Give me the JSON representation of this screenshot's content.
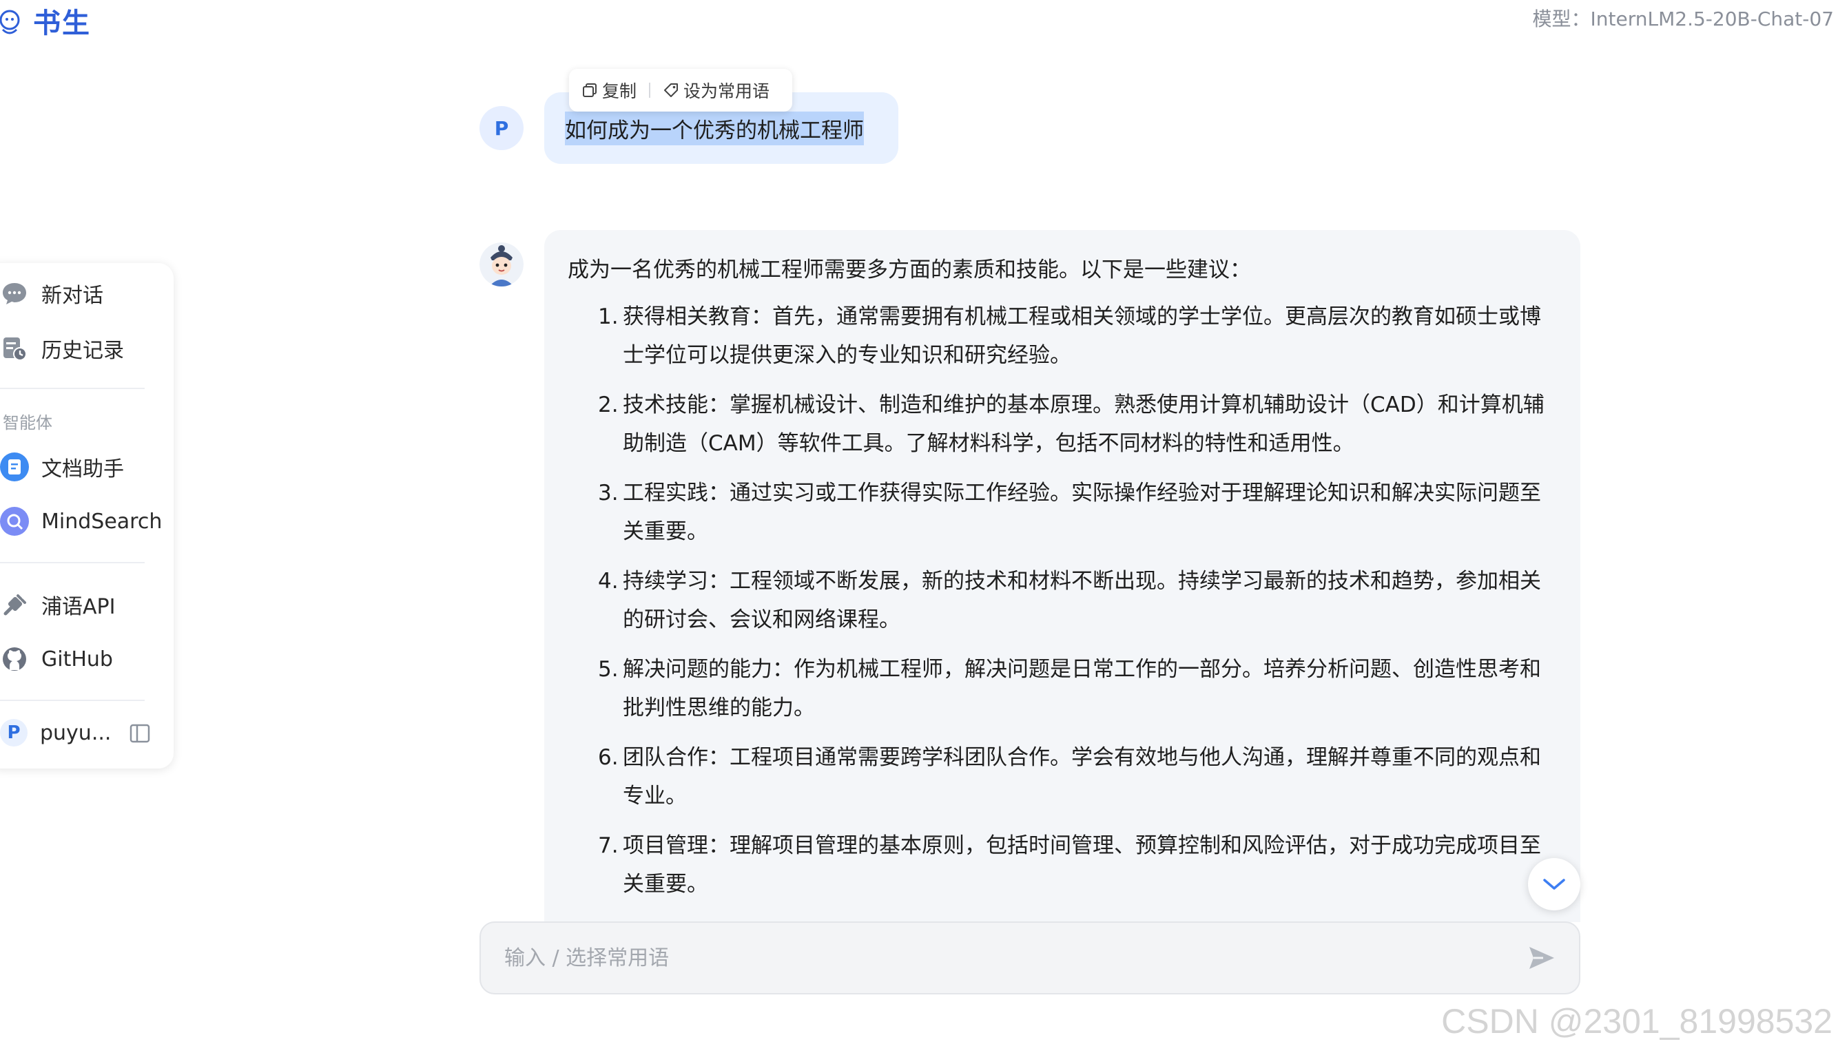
{
  "brand": {
    "name": "书生"
  },
  "header": {
    "model_label": "模型：InternLM2.5-20B-Chat-07"
  },
  "sidebar": {
    "items": [
      {
        "label": "新对话",
        "icon": "chat-bubble-icon"
      },
      {
        "label": "历史记录",
        "icon": "history-icon"
      }
    ],
    "agents_section_title": "智能体",
    "agents": [
      {
        "label": "文档助手",
        "icon": "document-assistant-icon"
      },
      {
        "label": "MindSearch",
        "icon": "mindsearch-icon"
      }
    ],
    "links": [
      {
        "label": "浦语API",
        "icon": "plug-icon"
      },
      {
        "label": "GitHub",
        "icon": "github-icon"
      }
    ],
    "user": {
      "avatar_letter": "P",
      "name": "puyu..."
    }
  },
  "chat": {
    "user_avatar_letter": "P",
    "toolbar": {
      "copy_label": "复制",
      "save_phrase_label": "设为常用语"
    },
    "user_message": "如何成为一个优秀的机械工程师",
    "bot_intro": "成为一名优秀的机械工程师需要多方面的素质和技能。以下是一些建议：",
    "bot_points": [
      {
        "num": "1.",
        "text": "获得相关教育：首先，通常需要拥有机械工程或相关领域的学士学位。更高层次的教育如硕士或博士学位可以提供更深入的专业知识和研究经验。"
      },
      {
        "num": "2.",
        "text": "技术技能：掌握机械设计、制造和维护的基本原理。熟悉使用计算机辅助设计（CAD）和计算机辅助制造（CAM）等软件工具。了解材料科学，包括不同材料的特性和适用性。"
      },
      {
        "num": "3.",
        "text": "工程实践：通过实习或工作获得实际工作经验。实际操作经验对于理解理论知识和解决实际问题至关重要。"
      },
      {
        "num": "4.",
        "text": "持续学习：工程领域不断发展，新的技术和材料不断出现。持续学习最新的技术和趋势，参加相关的研讨会、会议和网络课程。"
      },
      {
        "num": "5.",
        "text": "解决问题的能力：作为机械工程师，解决问题是日常工作的一部分。培养分析问题、创造性思考和批判性思维的能力。"
      },
      {
        "num": "6.",
        "text": "团队合作：工程项目通常需要跨学科团队合作。学会有效地与他人沟通，理解并尊重不同的观点和专业。"
      },
      {
        "num": "7.",
        "text": "项目管理：理解项目管理的基本原则，包括时间管理、预算控制和风险评估，对于成功完成项目至关重要。"
      }
    ]
  },
  "input": {
    "placeholder": "输入 / 选择常用语"
  },
  "watermark": {
    "text": "CSDN @2301_81998532"
  },
  "colors": {
    "accent": "#2f6fe0",
    "user_bubble": "#e8f1ff",
    "bot_bubble": "#f4f6f9",
    "selection": "#b9d4fb"
  }
}
